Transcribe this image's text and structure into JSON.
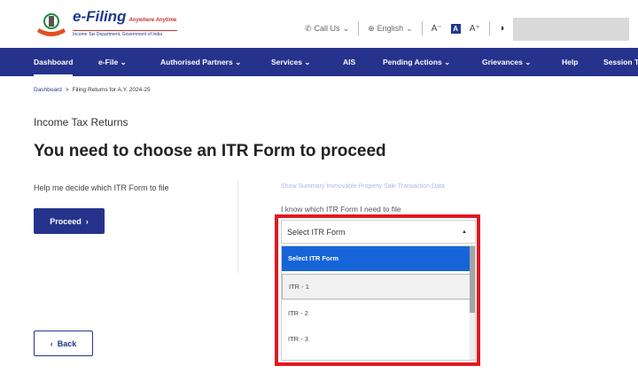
{
  "header": {
    "logo_title": "e-Filing",
    "logo_tagline": "Anywhere Anytime",
    "logo_subtitle": "Income Tax Department, Government of India",
    "call_us": "Call Us",
    "language": "English",
    "font_decrease": "A⁻",
    "font_default": "A",
    "font_increase": "A⁺",
    "contrast_icon": "contrast-icon"
  },
  "nav": {
    "items": [
      {
        "label": "Dashboard",
        "dropdown": false
      },
      {
        "label": "e-File",
        "dropdown": true
      },
      {
        "label": "Authorised Partners",
        "dropdown": true
      },
      {
        "label": "Services",
        "dropdown": true
      },
      {
        "label": "AIS",
        "dropdown": false
      },
      {
        "label": "Pending Actions",
        "dropdown": true
      },
      {
        "label": "Grievances",
        "dropdown": true
      },
      {
        "label": "Help",
        "dropdown": false
      },
      {
        "label": "Session Time",
        "dropdown": false
      }
    ]
  },
  "breadcrumb": {
    "home": "Dashboard",
    "separator": ">",
    "current": "Filing Returns for A.Y. 2024-25"
  },
  "main": {
    "section_title": "Income Tax Returns",
    "page_title": "You need to choose an ITR Form to proceed",
    "help_text": "Help me decide which ITR Form to file",
    "proceed_label": "Proceed",
    "proceed_arrow": "›",
    "summary_link": "Show Summary Immovable Property Sale Transaction Data",
    "know_text": "I know which ITR Form I need to file",
    "select_value": "Select ITR Form",
    "caret": "▲",
    "options": [
      "Select ITR Form",
      "ITR - 1",
      "ITR - 2",
      "ITR - 3"
    ],
    "back_label": "Back",
    "back_arrow": "‹"
  },
  "colors": {
    "nav_bg": "#26338c",
    "selected_option": "#1665d8",
    "highlight": "#e01921"
  }
}
